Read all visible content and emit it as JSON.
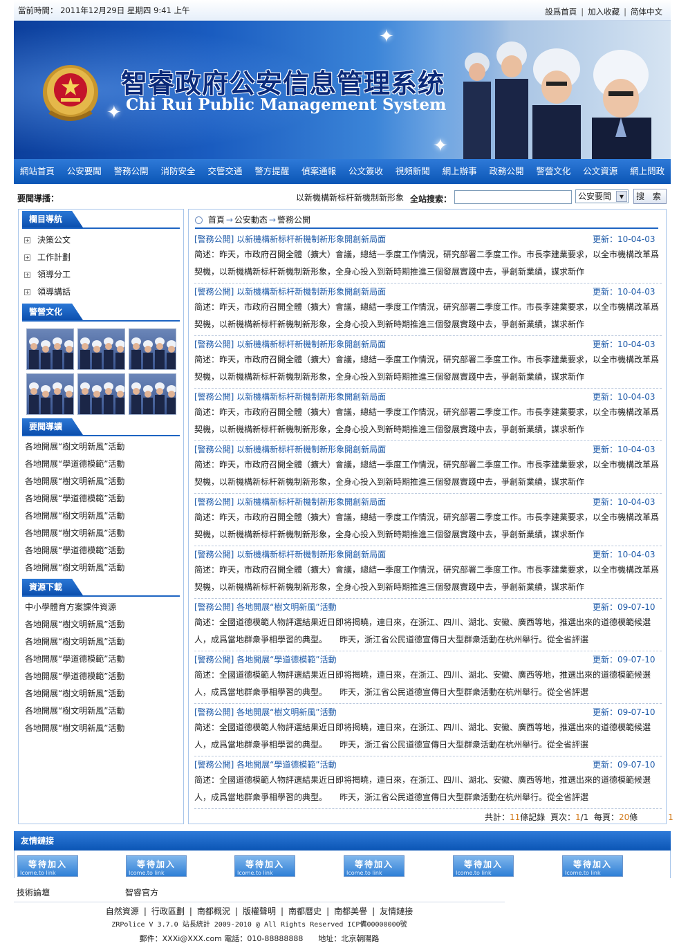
{
  "topbar": {
    "date_label": "當前時間：",
    "date_value": "2011年12月29日 星期四 9:41 上午",
    "links": [
      "設爲首頁",
      "加入收藏",
      "简体中文"
    ]
  },
  "banner": {
    "title_cn": "智睿政府公安信息管理系统",
    "title_en": "Chi Rui Public Management System"
  },
  "nav": [
    "網站首頁",
    "公安要聞",
    "警務公開",
    "消防安全",
    "交管交通",
    "警方提醒",
    "偵案通報",
    "公文簽收",
    "視頻新聞",
    "網上辦事",
    "政務公開",
    "警營文化",
    "公文資源",
    "網上問政"
  ],
  "searchbar": {
    "label": "要聞導播：",
    "ticker": "以新機構新标杆新機制新形象",
    "search_label": "全站搜索：",
    "search_value": "",
    "select_value": "公安要聞",
    "button": "搜 索"
  },
  "sidebar": {
    "sec1_title": "欄目導航",
    "categories": [
      "決策公文",
      "工作計劃",
      "領導分工",
      "領導講話"
    ],
    "sec2_title": "警營文化",
    "sec3_title": "要聞導讀",
    "news": [
      "各地開展“樹文明新風”活動",
      "各地開展“學道德模範”活動",
      "各地開展“樹文明新風”活動",
      "各地開展“學道德模範”活動",
      "各地開展“樹文明新風”活動",
      "各地開展“樹文明新風”活動",
      "各地開展“學道德模範”活動",
      "各地開展“樹文明新風”活動"
    ],
    "sec4_title": "資源下載",
    "downloads": [
      "中小學體育方案課件資源",
      "各地開展“樹文明新風”活動",
      "各地開展“樹文明新風”活動",
      "各地開展“學道德模範”活動",
      "各地開展“學道德模範”活動",
      "各地開展“樹文明新風”活動",
      "各地開展“樹文明新風”活動",
      "各地開展“樹文明新風”活動"
    ]
  },
  "breadcrumb": [
    "首頁",
    "公安動态",
    "警務公開"
  ],
  "articles": [
    {
      "title": "[警務公開] 以新機構新标杆新機制新形象開創新局面",
      "date": "更新：10-04-03",
      "summary": "简述：昨天，市政府召開全體（擴大）會議，總結一季度工作情況，研究部署二季度工作。市長李建業要求，以全市機構改革爲契機，以新機構新标杆新機制新形象，全身心投入到新時期推進三個發展實踐中去，爭創新業績，謀求新作"
    },
    {
      "title": "[警務公開] 以新機構新标杆新機制新形象開創新局面",
      "date": "更新：10-04-03",
      "summary": "简述：昨天，市政府召開全體（擴大）會議，總結一季度工作情況，研究部署二季度工作。市長李建業要求，以全市機構改革爲契機，以新機構新标杆新機制新形象，全身心投入到新時期推進三個發展實踐中去，爭創新業績，謀求新作"
    },
    {
      "title": "[警務公開] 以新機構新标杆新機制新形象開創新局面",
      "date": "更新：10-04-03",
      "summary": "简述：昨天，市政府召開全體（擴大）會議，總結一季度工作情況，研究部署二季度工作。市長李建業要求，以全市機構改革爲契機，以新機構新标杆新機制新形象，全身心投入到新時期推進三個發展實踐中去，爭創新業績，謀求新作"
    },
    {
      "title": "[警務公開] 以新機構新标杆新機制新形象開創新局面",
      "date": "更新：10-04-03",
      "summary": "简述：昨天，市政府召開全體（擴大）會議，總結一季度工作情況，研究部署二季度工作。市長李建業要求，以全市機構改革爲契機，以新機構新标杆新機制新形象，全身心投入到新時期推進三個發展實踐中去，爭創新業績，謀求新作"
    },
    {
      "title": "[警務公開] 以新機構新标杆新機制新形象開創新局面",
      "date": "更新：10-04-03",
      "summary": "简述：昨天，市政府召開全體（擴大）會議，總結一季度工作情況，研究部署二季度工作。市長李建業要求，以全市機構改革爲契機，以新機構新标杆新機制新形象，全身心投入到新時期推進三個發展實踐中去，爭創新業績，謀求新作"
    },
    {
      "title": "[警務公開] 以新機構新标杆新機制新形象開創新局面",
      "date": "更新：10-04-03",
      "summary": "简述：昨天，市政府召開全體（擴大）會議，總結一季度工作情況，研究部署二季度工作。市長李建業要求，以全市機構改革爲契機，以新機構新标杆新機制新形象，全身心投入到新時期推進三個發展實踐中去，爭創新業績，謀求新作"
    },
    {
      "title": "[警務公開] 以新機構新标杆新機制新形象開創新局面",
      "date": "更新：10-04-03",
      "summary": "简述：昨天，市政府召開全體（擴大）會議，總結一季度工作情況，研究部署二季度工作。市長李建業要求，以全市機構改革爲契機，以新機構新标杆新機制新形象，全身心投入到新時期推進三個發展實踐中去，爭創新業績，謀求新作"
    },
    {
      "title": "[警務公開] 各地開展“樹文明新風”活動",
      "date": "更新：09-07-10",
      "summary": "简述：全國道德模範人物評選結果近日即将揭曉，連日來，在浙江、四川、湖北、安徽、廣西等地，推選出來的道德模範候選人，成爲當地群衆爭相學習的典型。　　昨天，浙江省公民道德宣傳日大型群衆活動在杭州舉行。從全省評選"
    },
    {
      "title": "[警務公開] 各地開展“學道德模範”活動",
      "date": "更新：09-07-10",
      "summary": "简述：全國道德模範人物評選結果近日即将揭曉，連日來，在浙江、四川、湖北、安徽、廣西等地，推選出來的道德模範候選人，成爲當地群衆爭相學習的典型。　　昨天，浙江省公民道德宣傳日大型群衆活動在杭州舉行。從全省評選"
    },
    {
      "title": "[警務公開] 各地開展“樹文明新風”活動",
      "date": "更新：09-07-10",
      "summary": "简述：全國道德模範人物評選結果近日即将揭曉，連日來，在浙江、四川、湖北、安徽、廣西等地，推選出來的道德模範候選人，成爲當地群衆爭相學習的典型。　　昨天，浙江省公民道德宣傳日大型群衆活動在杭州舉行。從全省評選"
    },
    {
      "title": "[警務公開] 各地開展“學道德模範”活動",
      "date": "更新：09-07-10",
      "summary": "简述：全國道德模範人物評選結果近日即将揭曉，連日來，在浙江、四川、湖北、安徽、廣西等地，推選出來的道德模範候選人，成爲當地群衆爭相學習的典型。　　昨天，浙江省公民道德宣傳日大型群衆活動在杭州舉行。從全省評選"
    }
  ],
  "pager": {
    "total_label": "共計：",
    "total": "11",
    "records_label": "條記錄",
    "page_label": "頁次：",
    "page": "1",
    "page_total": "/1",
    "per_label": "每頁：",
    "per": "20",
    "per_unit": "條",
    "page_link": "1"
  },
  "friends": {
    "title": "友情鏈接",
    "logo_text": "等待加入",
    "logo_sub": "Icome.to link",
    "links": [
      "技術論壇",
      "智睿官方"
    ]
  },
  "footer": {
    "links": [
      "自然資源",
      "行政區劃",
      "南都概況",
      "版權聲明",
      "南都曆史",
      "南都美譽",
      "友情鏈接"
    ],
    "copyright": "ZRPolice V 3.7.0 站長統計 2009-2010 @ All Rights Reserved ICP備00000000號",
    "contact": "郵件：XXXi@XXX.com 電話：010-88888888　　地址：北京朝陽路"
  },
  "colors": {
    "brand_blue": "#0b55b5",
    "link_blue": "#1e5aa8",
    "accent_orange": "#d27a1a"
  }
}
